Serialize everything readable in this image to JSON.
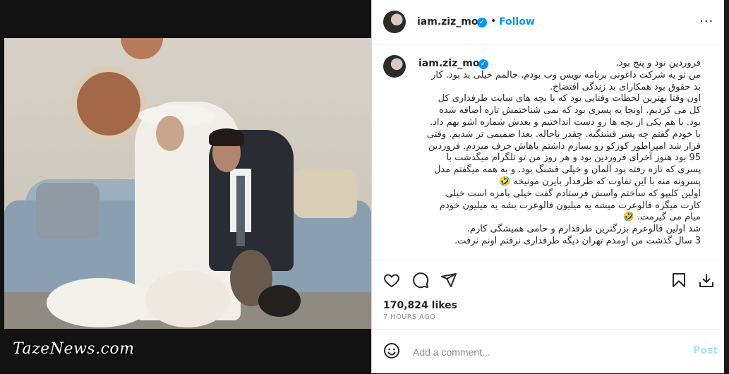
{
  "watermark": "TazeNews.com",
  "post": {
    "author": "iam.ziz_mou",
    "follow_label": "Follow",
    "separator": "•",
    "more_label": "···",
    "caption_lines": [
      "فروردین نود و پنج بود.",
      "من تو یه شرکت داغونی برنامه نویس وب بودم. حالمم خیلی بد بود. کار",
      "بد حقوق بود همکارای بد زندگی افتضاح.",
      "اون وقتا بهترین لحظات وقتایی بود که با بچه های سایت طرفداری کل",
      "کل می کردیم. اونجا یه پسری بود که نمی شناختمش تازه اضافه شده",
      "بود. با هم یکی از بچه ها رو دست انداختیم و بعدش شماره اشو بهم داد.",
      "با خودم گفتم چه پسر قشنگیه. چقدر باحاله. بعدا صمیمی تر شدیم. وقتی",
      "قرار شد امپراطور کوزکو رو بسازم داشتم باهاش حرف میزدم. فروردین",
      "95 بود هنوز آخرای فروردین بود و هر روز من تو تلگرام میگذشت با",
      "پسری که تازه رفته بود آلمان و خیلی قشنگ بود. و به همه میگفتم مدل",
      "پسرونه منه با این تفاوت که طرفدار بایرن مونیخه 🤣",
      "اولین کلیپو که ساختم واسش فرستادم گفت خیلی بامزه است خیلی",
      "کارت میگره فالوعرت میشه یه میلیون فالوعرت بشه یه میلیون خودم",
      "میام می گیرمت. 🤣",
      "شد اولین فالوعرم بزرگترین طرفدارم و حامی همیشگی کارم.",
      "3 سال گذشت من اومدم تهران دیگه طرفداری نرفتم اونم نرفت."
    ],
    "likes": "170,824 likes",
    "time": "7 HOURS AGO",
    "comment_placeholder": "Add a comment...",
    "post_label": "Post"
  },
  "icons": {
    "verified": "verified-badge-icon",
    "like": "heart-icon",
    "comment": "comment-icon",
    "share": "send-icon",
    "save": "bookmark-icon",
    "download": "download-icon",
    "emoji": "emoji-icon"
  },
  "colors": {
    "accent": "#0095f6",
    "post_disabled": "#b2dffc",
    "text": "#262626",
    "muted": "#8e8e8e"
  }
}
